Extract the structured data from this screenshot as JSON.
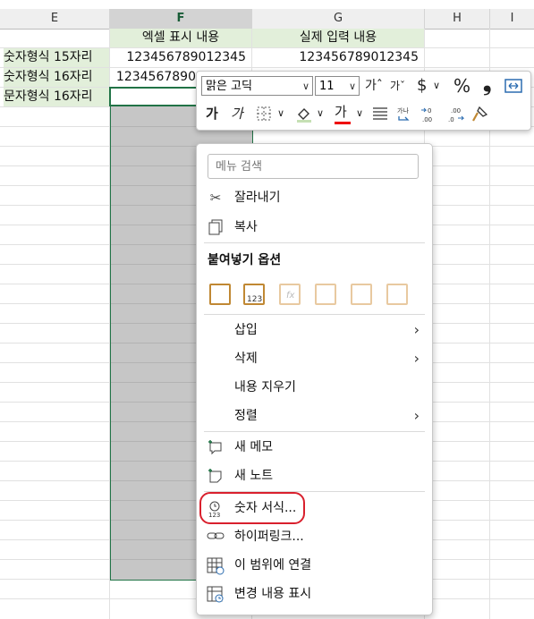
{
  "columns": [
    "E",
    "F",
    "G",
    "H",
    "I"
  ],
  "header_row": {
    "f": "엑셀 표시 내용",
    "g": "실제 입력 내용"
  },
  "rows": [
    {
      "label": "숫자형식 15자리",
      "f": "123456789012345",
      "g": "123456789012345"
    },
    {
      "label": "숫자형식 16자리",
      "f": "1234567890",
      "g": ""
    },
    {
      "label": "문자형식 16자리",
      "f": "",
      "g": ""
    }
  ],
  "mini_toolbar": {
    "font_name": "맑은 고딕",
    "font_size": "11",
    "bold": "가",
    "italic": "가",
    "increase_font": "가ˆ",
    "decrease_font": "가ˇ",
    "currency": "$",
    "percent": "%",
    "comma": "❟",
    "font_color_letter": "가"
  },
  "context_menu": {
    "search_placeholder": "메뉴 검색",
    "cut": "잘라내기",
    "copy": "복사",
    "paste_options": "붙여넣기 옵션",
    "insert": "삽입",
    "delete": "삭제",
    "clear_contents": "내용 지우기",
    "sort": "정렬",
    "new_comment": "새 메모",
    "new_note": "새 노트",
    "format_cells": "숫자 서식...",
    "hyperlink": "하이퍼링크...",
    "link_to_range": "이 범위에 연결",
    "show_changes": "변경 내용 표시"
  },
  "colors": {
    "accent": "#217346",
    "highlight": "#d9202d",
    "header_fill": "#e2efda"
  }
}
